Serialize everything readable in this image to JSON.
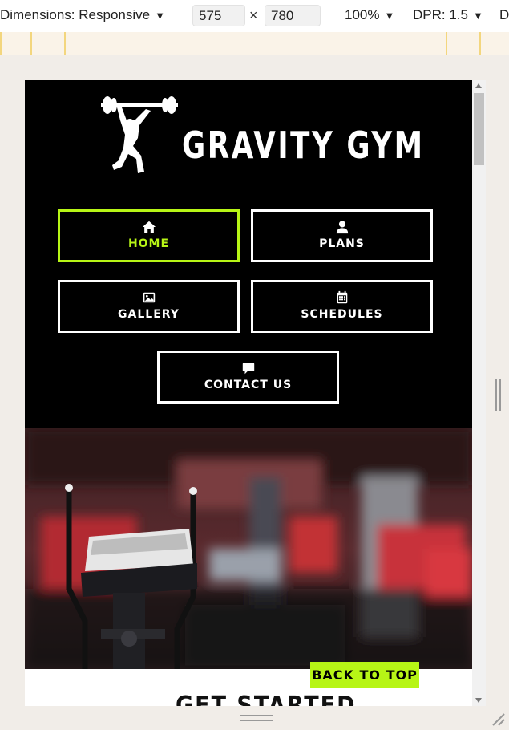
{
  "devtools": {
    "dimensions_label": "Dimensions: Responsive",
    "width_value": "575",
    "height_value": "780",
    "times": "×",
    "zoom": "100%",
    "dpr": "DPR: 1.5",
    "overflow_label": "D",
    "caret": "▼"
  },
  "site": {
    "brand": "GRAVITY GYM",
    "nav": [
      {
        "label": "HOME",
        "icon": "home-icon",
        "active": true
      },
      {
        "label": "PLANS",
        "icon": "user-icon",
        "active": false
      },
      {
        "label": "GALLERY",
        "icon": "image-icon",
        "active": false
      },
      {
        "label": "SCHEDULES",
        "icon": "calendar-icon",
        "active": false
      },
      {
        "label": "CONTACT US",
        "icon": "chat-icon",
        "active": false
      }
    ],
    "back_to_top": "BACK TO TOP",
    "section_heading": "GET STARTED"
  },
  "colors": {
    "accent": "#b7f516",
    "header_bg": "#000000"
  }
}
